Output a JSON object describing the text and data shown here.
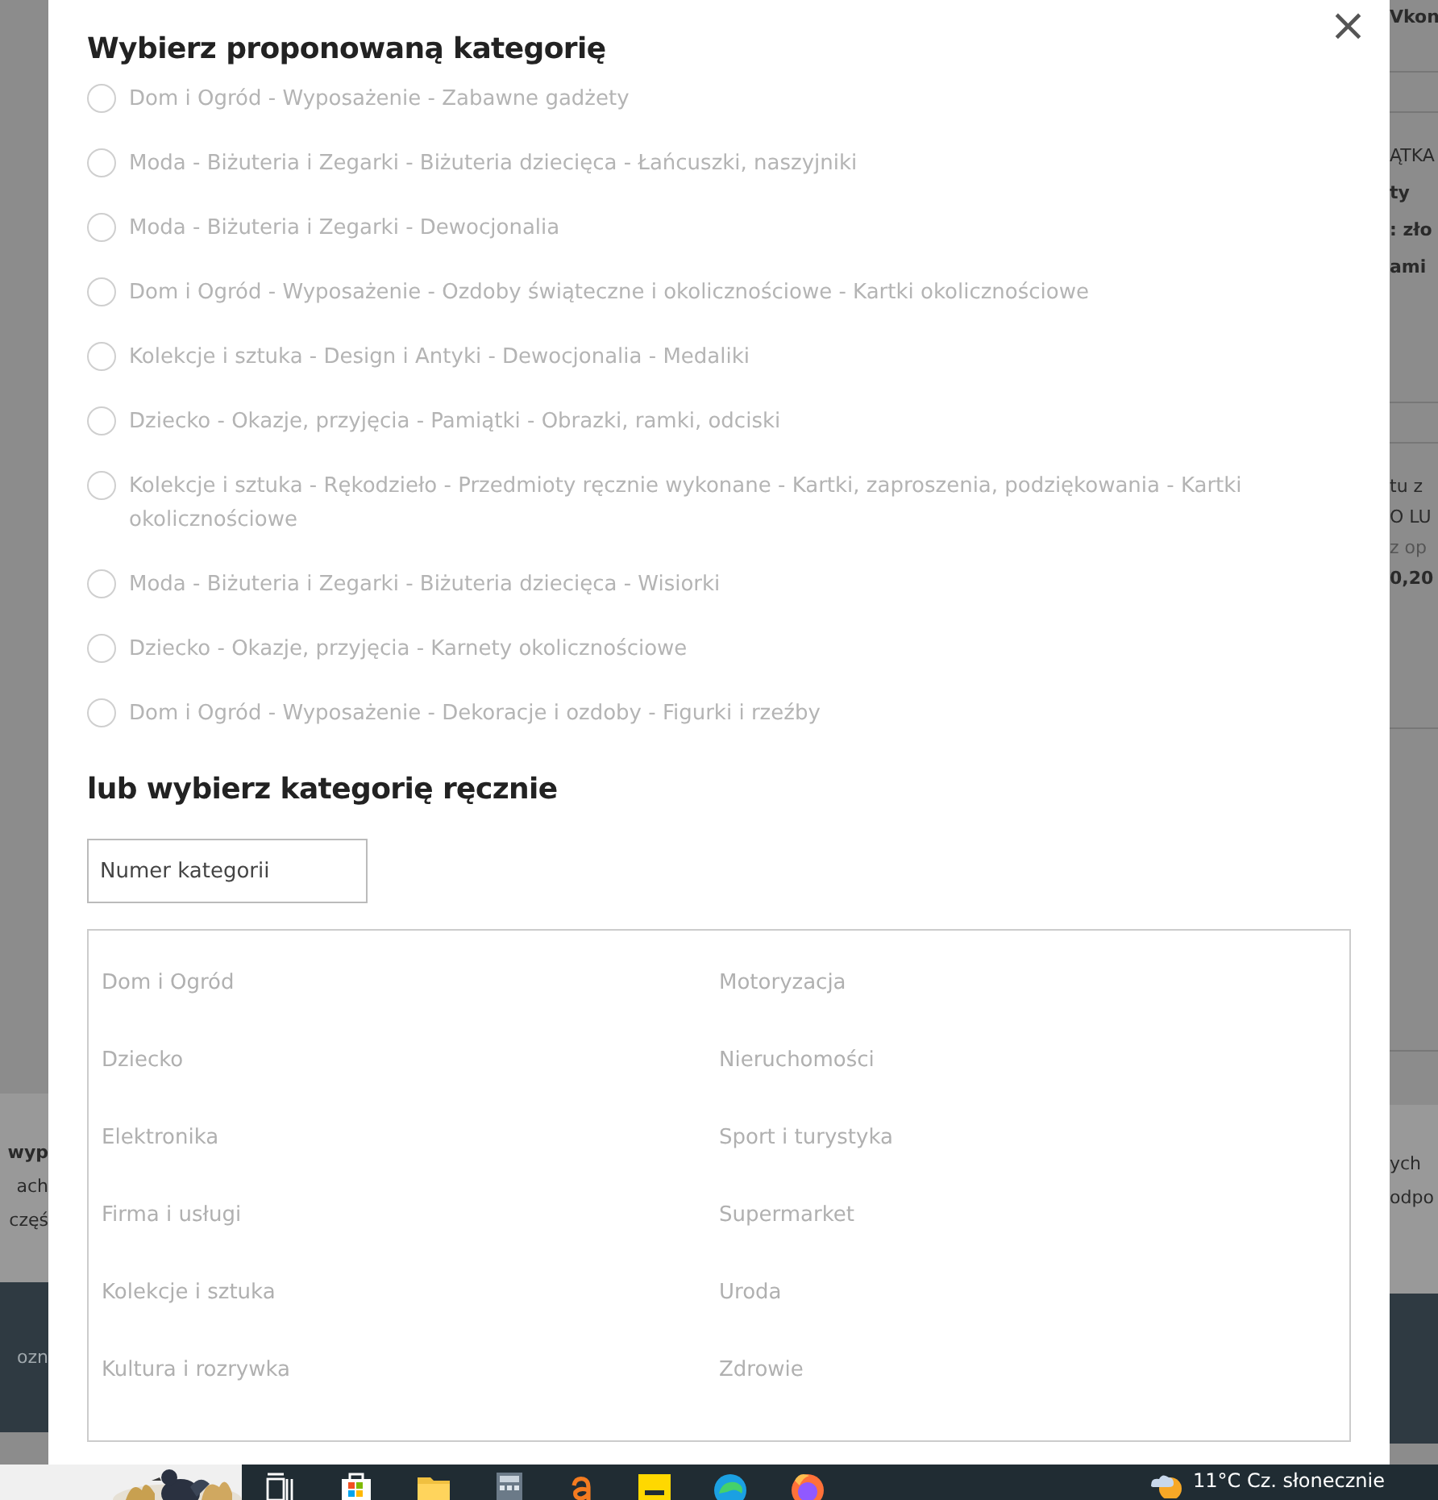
{
  "left_edge": {
    "sections": [
      {
        "kind": "panel"
      },
      {
        "kind": "band",
        "texts": [
          {
            "text": "wyp",
            "kind": "bold"
          },
          {
            "text": "ach",
            "kind": "plain"
          },
          {
            "text": "częś",
            "kind": "plain"
          }
        ]
      },
      {
        "kind": "footer",
        "texts": [
          {
            "text": "ozn",
            "kind": "muted"
          }
        ]
      }
    ]
  },
  "right_edge": {
    "sections": [
      {
        "kind": "top",
        "texts": [
          {
            "text": "Vkon",
            "kind": "bold"
          }
        ]
      },
      {
        "kind": "gap"
      },
      {
        "kind": "panel",
        "texts": [
          {
            "text": "ĄTKA",
            "kind": "plain"
          },
          {
            "text": "ty",
            "kind": "bold"
          },
          {
            "text": ": zło",
            "kind": "bold"
          },
          {
            "text": "ami",
            "kind": "bold"
          }
        ]
      },
      {
        "kind": "gap"
      },
      {
        "kind": "panel",
        "texts": [
          {
            "text": "tu z",
            "kind": "plain"
          },
          {
            "text": "O LU",
            "kind": "plain"
          },
          {
            "text": "z op",
            "kind": "muted"
          },
          {
            "text": "0,20",
            "kind": "bold"
          }
        ]
      },
      {
        "kind": "fill"
      },
      {
        "kind": "band",
        "texts": [
          {
            "text": "ych",
            "kind": "plain"
          },
          {
            "text": "odpo",
            "kind": "plain"
          }
        ]
      },
      {
        "kind": "footer"
      }
    ]
  },
  "modal": {
    "title": "Wybierz proponowaną kategorię",
    "close": "×",
    "options": [
      {
        "label": "Dom i Ogród - Wyposażenie - Zabawne gadżety",
        "selected": false
      },
      {
        "label": "Moda - Biżuteria i Zegarki - Biżuteria dziecięca - Łańcuszki, naszyjniki",
        "selected": false
      },
      {
        "label": "Moda - Biżuteria i Zegarki - Dewocjonalia",
        "selected": false
      },
      {
        "label": "Dom i Ogród - Wyposażenie - Ozdoby świąteczne i okolicznościowe - Kartki okolicznościowe",
        "selected": false
      },
      {
        "label": "Kolekcje i sztuka - Design i Antyki - Dewocjonalia - Medaliki",
        "selected": false
      },
      {
        "label": "Dziecko - Okazje, przyjęcia - Pamiątki - Obrazki, ramki, odciski",
        "selected": false
      },
      {
        "label": "Kolekcje i sztuka - Rękodzieło - Przedmioty ręcznie wykonane - Kartki, zaproszenia, podziękowania - Kartki okolicznościowe",
        "selected": false
      },
      {
        "label": "Moda - Biżuteria i Zegarki - Biżuteria dziecięca - Wisiorki",
        "selected": false
      },
      {
        "label": "Dziecko - Okazje, przyjęcia - Karnety okolicznościowe",
        "selected": false
      },
      {
        "label": "Dom i Ogród - Wyposażenie - Dekoracje i ozdoby - Figurki i rzeźby",
        "selected": false
      }
    ],
    "manual_title": "lub wybierz kategorię ręcznie",
    "search": {
      "placeholder": "Numer kategorii"
    },
    "categories": [
      "Dom i Ogród",
      "Motoryzacja",
      "Dziecko",
      "Nieruchomości",
      "Elektronika",
      "Sport i turystyka",
      "Firma i usługi",
      "Supermarket",
      "Kolekcje i sztuka",
      "Uroda",
      "Kultura i rozrywka",
      "Zdrowie"
    ]
  },
  "taskbar": {
    "weather": "11°C  Cz. słonecznie"
  }
}
